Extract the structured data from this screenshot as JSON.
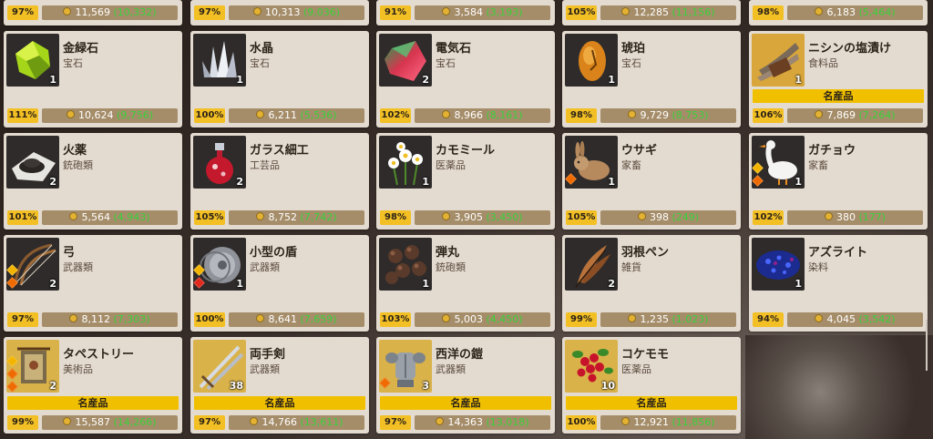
{
  "top_row": [
    {
      "pct": "97%",
      "price": "11,569",
      "compare": "(10,332)"
    },
    {
      "pct": "97%",
      "price": "10,313",
      "compare": "(9,036)"
    },
    {
      "pct": "91%",
      "price": "3,584",
      "compare": "(3,193)"
    },
    {
      "pct": "105%",
      "price": "12,285",
      "compare": "(11,156)"
    },
    {
      "pct": "98%",
      "price": "6,183",
      "compare": "(5,464)"
    }
  ],
  "rows": [
    [
      {
        "name": "金緑石",
        "category": "宝石",
        "qty": "1",
        "pct": "111%",
        "price": "10,624",
        "compare": "(9,756)",
        "special": "",
        "icon": "chrysoberyl-icon"
      },
      {
        "name": "水晶",
        "category": "宝石",
        "qty": "1",
        "pct": "100%",
        "price": "6,211",
        "compare": "(5,536)",
        "special": "",
        "icon": "crystal-icon"
      },
      {
        "name": "電気石",
        "category": "宝石",
        "qty": "2",
        "pct": "102%",
        "price": "8,966",
        "compare": "(8,161)",
        "special": "",
        "icon": "tourmaline-icon"
      },
      {
        "name": "琥珀",
        "category": "宝石",
        "qty": "1",
        "pct": "98%",
        "price": "9,729",
        "compare": "(8,753)",
        "special": "",
        "icon": "amber-icon"
      },
      {
        "name": "ニシンの塩漬け",
        "category": "食料品",
        "qty": "1",
        "pct": "106%",
        "price": "7,869",
        "compare": "(7,264)",
        "special": "名産品",
        "icon": "salted-herring-icon"
      }
    ],
    [
      {
        "name": "火薬",
        "category": "銃砲類",
        "qty": "2",
        "pct": "101%",
        "price": "5,564",
        "compare": "(4,943)",
        "special": "",
        "icon": "gunpowder-icon"
      },
      {
        "name": "ガラス細工",
        "category": "工芸品",
        "qty": "2",
        "pct": "105%",
        "price": "8,752",
        "compare": "(7,742)",
        "special": "",
        "icon": "glasswork-icon"
      },
      {
        "name": "カモミール",
        "category": "医薬品",
        "qty": "1",
        "pct": "98%",
        "price": "3,905",
        "compare": "(3,450)",
        "special": "",
        "icon": "chamomile-icon"
      },
      {
        "name": "ウサギ",
        "category": "家畜",
        "qty": "1",
        "pct": "105%",
        "price": "398",
        "compare": "(249)",
        "special": "",
        "icon": "rabbit-icon"
      },
      {
        "name": "ガチョウ",
        "category": "家畜",
        "qty": "1",
        "pct": "102%",
        "price": "380",
        "compare": "(177)",
        "special": "",
        "icon": "goose-icon"
      }
    ],
    [
      {
        "name": "弓",
        "category": "武器類",
        "qty": "2",
        "pct": "97%",
        "price": "8,112",
        "compare": "(7,303)",
        "special": "",
        "icon": "bow-icon"
      },
      {
        "name": "小型の盾",
        "category": "武器類",
        "qty": "1",
        "pct": "100%",
        "price": "8,641",
        "compare": "(7,659)",
        "special": "",
        "icon": "small-shield-icon"
      },
      {
        "name": "弾丸",
        "category": "銃砲類",
        "qty": "1",
        "pct": "103%",
        "price": "5,003",
        "compare": "(4,450)",
        "special": "",
        "icon": "bullets-icon"
      },
      {
        "name": "羽根ペン",
        "category": "雑貨",
        "qty": "2",
        "pct": "99%",
        "price": "1,235",
        "compare": "(1,023)",
        "special": "",
        "icon": "quill-pen-icon"
      },
      {
        "name": "アズライト",
        "category": "染料",
        "qty": "1",
        "pct": "94%",
        "price": "4,045",
        "compare": "(3,542)",
        "special": "",
        "icon": "azurite-icon"
      }
    ],
    [
      {
        "name": "タペストリー",
        "category": "美術品",
        "qty": "2",
        "pct": "99%",
        "price": "15,587",
        "compare": "(14,266)",
        "special": "名産品",
        "icon": "tapestry-icon"
      },
      {
        "name": "両手剣",
        "category": "武器類",
        "qty": "38",
        "pct": "97%",
        "price": "14,766",
        "compare": "(13,611)",
        "special": "名産品",
        "icon": "two-handed-sword-icon"
      },
      {
        "name": "西洋の鎧",
        "category": "武器類",
        "qty": "3",
        "pct": "97%",
        "price": "14,363",
        "compare": "(13,018)",
        "special": "名産品",
        "icon": "western-armor-icon"
      },
      {
        "name": "コケモモ",
        "category": "医薬品",
        "qty": "10",
        "pct": "100%",
        "price": "12,921",
        "compare": "(11,856)",
        "special": "名産品",
        "icon": "lingonberry-icon"
      }
    ]
  ],
  "colors": {
    "card_bg": "#e4dbd0",
    "pct_badge": "#f2bf24",
    "price_bar": "#a58d6a",
    "compare_text": "#3ad23a",
    "special_bar": "#f0c000"
  }
}
